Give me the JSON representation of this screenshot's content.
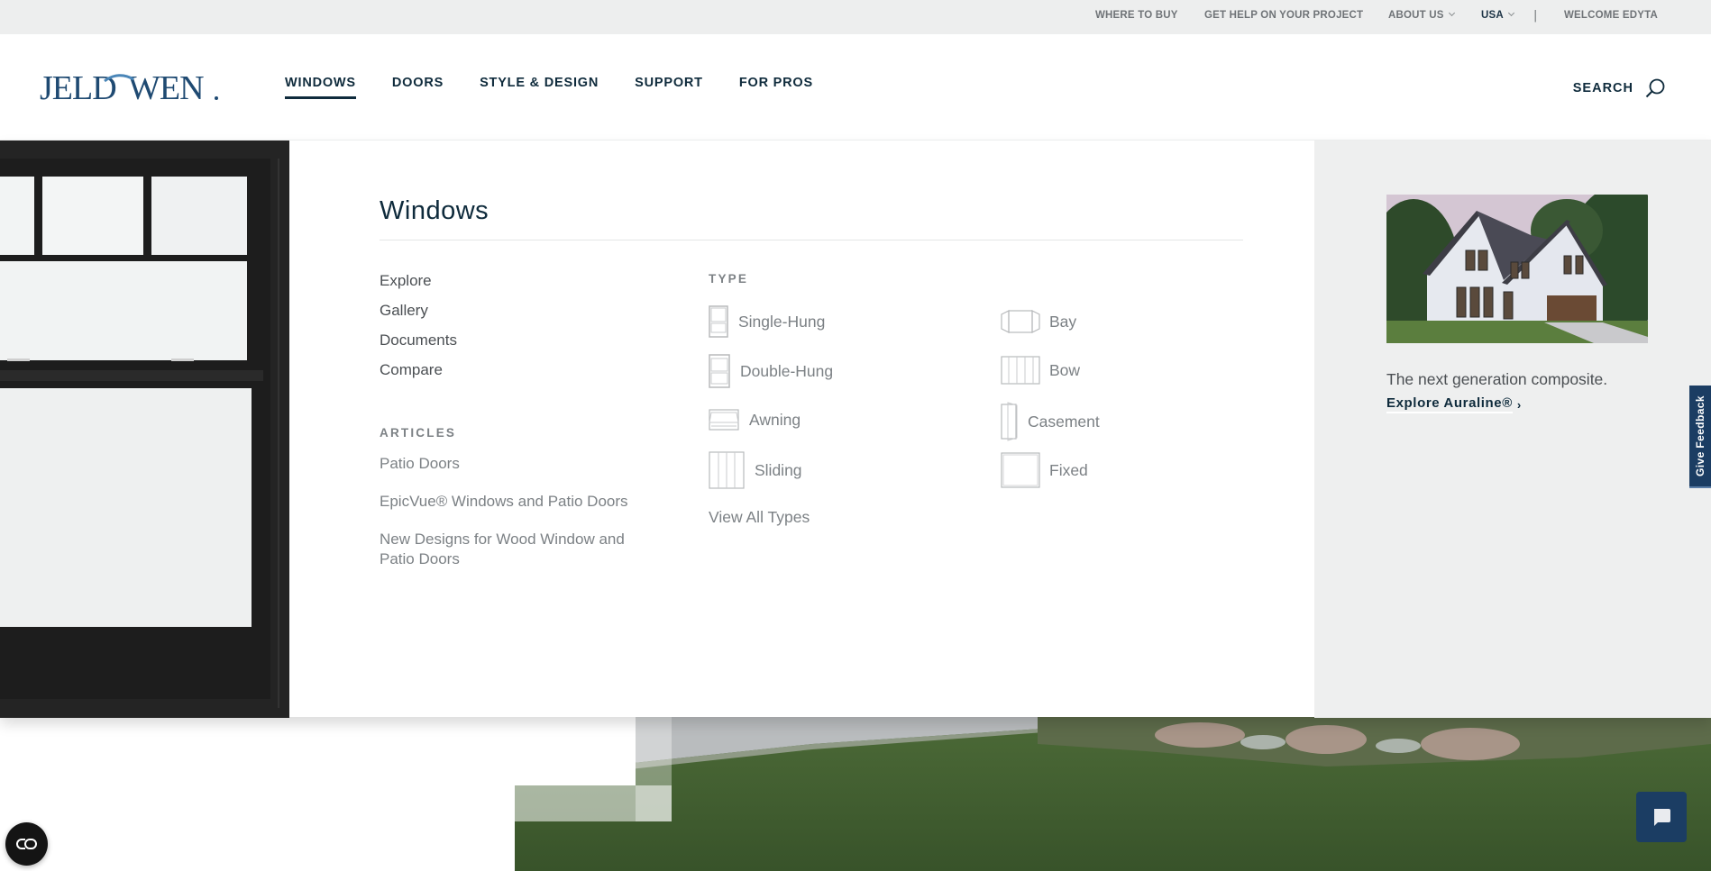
{
  "utility_nav": {
    "where_to_buy": "WHERE TO BUY",
    "get_help": "GET HELP ON YOUR PROJECT",
    "about_us": "ABOUT US",
    "country": "USA",
    "separator": "|",
    "welcome": "WELCOME EDYTA"
  },
  "brand": {
    "name": "JELD-WEN",
    "logo_text_left": "JELD",
    "logo_text_right": "WEN",
    "color": "#1f4a72"
  },
  "main_nav": {
    "items": [
      {
        "label": "WINDOWS",
        "active": true
      },
      {
        "label": "DOORS",
        "active": false
      },
      {
        "label": "STYLE & DESIGN",
        "active": false
      },
      {
        "label": "SUPPORT",
        "active": false
      },
      {
        "label": "FOR PROS",
        "active": false
      }
    ],
    "search_label": "SEARCH"
  },
  "mega_menu": {
    "title": "Windows",
    "links": [
      "Explore",
      "Gallery",
      "Documents",
      "Compare"
    ],
    "articles_label": "ARTICLES",
    "articles": [
      "Patio Doors",
      "EpicVue® Windows and Patio Doors",
      "New Designs for Wood Window and Patio Doors"
    ],
    "type_label": "TYPE",
    "types_col1": [
      {
        "label": "Single-Hung",
        "icon": "single-hung-window-icon"
      },
      {
        "label": "Double-Hung",
        "icon": "double-hung-window-icon"
      },
      {
        "label": "Awning",
        "icon": "awning-window-icon"
      },
      {
        "label": "Sliding",
        "icon": "sliding-window-icon"
      }
    ],
    "types_col2": [
      {
        "label": "Bay",
        "icon": "bay-window-icon"
      },
      {
        "label": "Bow",
        "icon": "bow-window-icon"
      },
      {
        "label": "Casement",
        "icon": "casement-window-icon"
      },
      {
        "label": "Fixed",
        "icon": "fixed-window-icon"
      }
    ],
    "view_all": "View All Types",
    "promo": {
      "text": "The next generation composite.",
      "link": "Explore Auraline®",
      "link_arrow": "›"
    }
  },
  "feedback_tab": "Give Feedback",
  "colors": {
    "navy": "#0f2b3c",
    "accent_blue": "#1b3d63",
    "muted_text": "#7c8185",
    "utility_bg": "#edeeee",
    "promo_bg": "#eeefef"
  }
}
